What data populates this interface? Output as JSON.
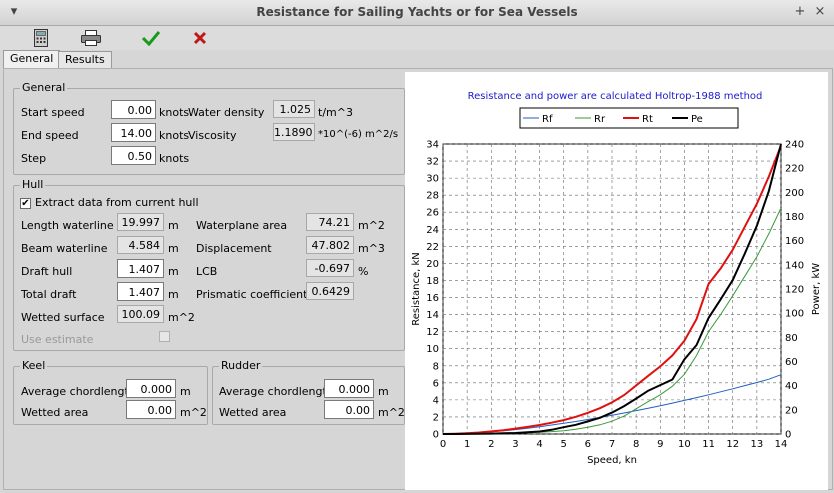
{
  "window": {
    "title": "Resistance for Sailing Yachts or for Sea Vessels"
  },
  "tabs": [
    "General",
    "Results"
  ],
  "general": {
    "title": "General",
    "start_speed": {
      "label": "Start speed",
      "value": "0.00",
      "unit": "knots"
    },
    "end_speed": {
      "label": "End speed",
      "value": "14.00",
      "unit": "knots"
    },
    "step": {
      "label": "Step",
      "value": "0.50",
      "unit": "knots"
    },
    "water_density": {
      "label": "Water density",
      "value": "1.025",
      "unit": "t/m^3"
    },
    "viscosity": {
      "label": "Viscosity",
      "value": "1.1890",
      "unit": "*10^(-6) m^2/s"
    }
  },
  "hull": {
    "title": "Hull",
    "extract_label": "Extract data from current hull",
    "extract_checked": true,
    "length_waterline": {
      "label": "Length waterline",
      "value": "19.997",
      "unit": "m"
    },
    "beam_waterline": {
      "label": "Beam waterline",
      "value": "4.584",
      "unit": "m"
    },
    "draft_hull": {
      "label": "Draft hull",
      "value": "1.407",
      "unit": "m"
    },
    "total_draft": {
      "label": "Total draft",
      "value": "1.407",
      "unit": "m"
    },
    "wetted_surface": {
      "label": "Wetted surface",
      "value": "100.09",
      "unit": "m^2"
    },
    "use_estimate": "Use estimate",
    "waterplane_area": {
      "label": "Waterplane area",
      "value": "74.21",
      "unit": "m^2"
    },
    "displacement": {
      "label": "Displacement",
      "value": "47.802",
      "unit": "m^3"
    },
    "lcb": {
      "label": "LCB",
      "value": "-0.697",
      "unit": "%"
    },
    "prismatic": {
      "label": "Prismatic coefficient",
      "value": "0.6429"
    }
  },
  "keel": {
    "title": "Keel",
    "chord": {
      "label": "Average chordlength",
      "value": "0.000",
      "unit": "m"
    },
    "wetted": {
      "label": "Wetted area",
      "value": "0.00",
      "unit": "m^2"
    }
  },
  "rudder": {
    "title": "Rudder",
    "chord": {
      "label": "Average chordlength",
      "value": "0.000",
      "unit": "m"
    },
    "wetted": {
      "label": "Wetted area",
      "value": "0.00",
      "unit": "m^2"
    }
  },
  "chart_data": {
    "type": "line",
    "title": "Resistance and power are calculated Holtrop-1988 method",
    "xlabel": "Speed, kn",
    "ylabel": "Resistance, kN",
    "y2label": "Power, kW",
    "xlim": [
      0,
      14
    ],
    "ylim": [
      0,
      34
    ],
    "y2lim": [
      0,
      240
    ],
    "xticks": [
      0,
      1,
      2,
      3,
      4,
      5,
      6,
      7,
      8,
      9,
      10,
      11,
      12,
      13,
      14
    ],
    "yticks": [
      0,
      2,
      4,
      6,
      8,
      10,
      12,
      14,
      16,
      18,
      20,
      22,
      24,
      26,
      28,
      30,
      32,
      34
    ],
    "y2ticks": [
      0,
      20,
      40,
      60,
      80,
      100,
      120,
      140,
      160,
      180,
      200,
      220,
      240
    ],
    "grid": true,
    "legend_position": "top",
    "x": [
      0.5,
      1,
      1.5,
      2,
      2.5,
      3,
      3.5,
      4,
      4.5,
      5,
      5.5,
      6,
      6.5,
      7,
      7.5,
      8,
      8.5,
      9,
      9.5,
      10,
      10.5,
      11,
      11.5,
      12,
      12.5,
      13,
      13.5,
      14
    ],
    "series": [
      {
        "name": "Rf",
        "color": "#1f5fbf",
        "axis": "left",
        "values": [
          0.03,
          0.08,
          0.16,
          0.26,
          0.38,
          0.52,
          0.68,
          0.86,
          1.05,
          1.25,
          1.47,
          1.7,
          1.95,
          2.2,
          2.46,
          2.74,
          3.02,
          3.32,
          3.62,
          3.94,
          4.27,
          4.6,
          4.95,
          5.3,
          5.67,
          6.04,
          6.43,
          6.95
        ]
      },
      {
        "name": "Rr",
        "color": "#3a9a3a",
        "axis": "left",
        "values": [
          0.0,
          0.0,
          0.02,
          0.04,
          0.07,
          0.11,
          0.15,
          0.2,
          0.28,
          0.38,
          0.55,
          0.78,
          1.08,
          1.5,
          2.1,
          2.95,
          3.8,
          4.6,
          5.6,
          7.0,
          9.2,
          12.0,
          14.0,
          16.2,
          18.5,
          20.8,
          23.5,
          26.5
        ]
      },
      {
        "name": "Rt",
        "color": "#e01010",
        "axis": "left",
        "values": [
          0.04,
          0.09,
          0.18,
          0.3,
          0.45,
          0.63,
          0.83,
          1.05,
          1.33,
          1.63,
          2.02,
          2.48,
          3.03,
          3.7,
          4.56,
          5.69,
          6.82,
          7.92,
          9.22,
          10.94,
          13.47,
          17.6,
          19.4,
          21.6,
          24.3,
          27.0,
          30.2,
          33.8
        ]
      },
      {
        "name": "Pe",
        "color": "#000000",
        "axis": "right",
        "values": [
          0.0,
          0.1,
          0.2,
          0.3,
          0.6,
          0.8,
          1.4,
          2.1,
          3.5,
          5.6,
          7.6,
          10.4,
          13.4,
          17.7,
          23.1,
          29.3,
          35.8,
          40.5,
          45.1,
          61.8,
          73.6,
          96.1,
          111.4,
          127.4,
          149.3,
          172.4,
          201.3,
          240.0
        ]
      }
    ]
  }
}
